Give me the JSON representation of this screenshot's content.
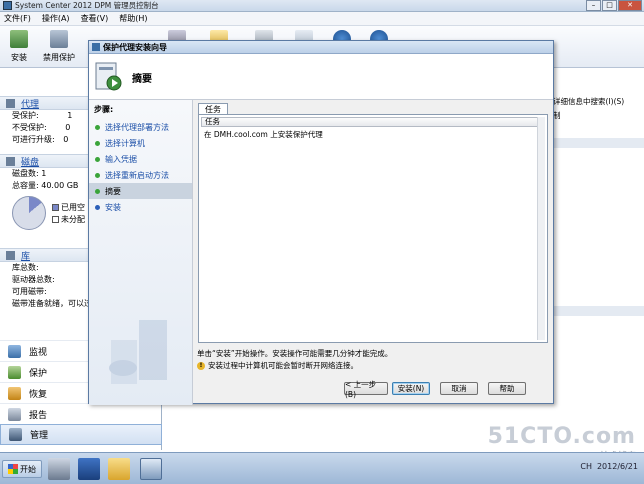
{
  "window": {
    "title": "System Center 2012 DPM 管理员控制台"
  },
  "menu": {
    "file": "文件(F)",
    "action": "操作(A)",
    "view": "查看(V)",
    "help": "帮助(H)"
  },
  "ribbon": {
    "install": "安装",
    "disable_protection": "禁用保护"
  },
  "left": {
    "agent": {
      "title": "代理",
      "protected_label": "受保护:",
      "protected_value": "1",
      "unprotected_label": "不受保护:",
      "unprotected_value": "0",
      "upgradable_label": "可进行升级:",
      "upgradable_value": "0"
    },
    "disk": {
      "title": "磁盘",
      "count_label": "磁盘数:",
      "count_value": "1",
      "capacity_label": "总容量:",
      "capacity_value": "40.00 GB",
      "used_label": "已用空",
      "unallocated_label": "未分配"
    },
    "library": {
      "title": "库",
      "total_label": "库总数:",
      "drives_label": "驱动器总数:",
      "available_label": "可用磁带:",
      "prepare_label": "磁带准备就绪，可以过"
    },
    "nav": {
      "monitor": "监视",
      "protection": "保护",
      "recovery": "恢复",
      "reports": "报告",
      "management": "管理"
    }
  },
  "content": {
    "search_hint": "详细信息中搜索(I)(S)",
    "col": "制"
  },
  "dialog": {
    "title": "保护代理安装向导",
    "header": "摘要",
    "steps_title": "步骤:",
    "steps": [
      "选择代理部署方法",
      "选择计算机",
      "输入凭据",
      "选择重新启动方法",
      "摘要",
      "安装"
    ],
    "tab": "任务",
    "grid_header": "任务",
    "task_row": "在 DMH.cool.com 上安装保护代理",
    "info": "单击“安装”开始操作。安装操作可能需要几分钟才能完成。",
    "warning": "安装过程中计算机可能会暂时断开网络连接。",
    "btn_back": "< 上一步(B)",
    "btn_install": "安装(N)",
    "btn_cancel": "取消",
    "btn_help": "帮助"
  },
  "taskbar": {
    "start": "开始",
    "lang": "CH",
    "date": "2012/6/21"
  },
  "watermark": {
    "line1": "51CTO.com",
    "line2": "技术博客"
  },
  "colors": {
    "accent": "#1a4ea7",
    "title_bar": "#c9d8ea",
    "warning": "#e7b52a"
  }
}
